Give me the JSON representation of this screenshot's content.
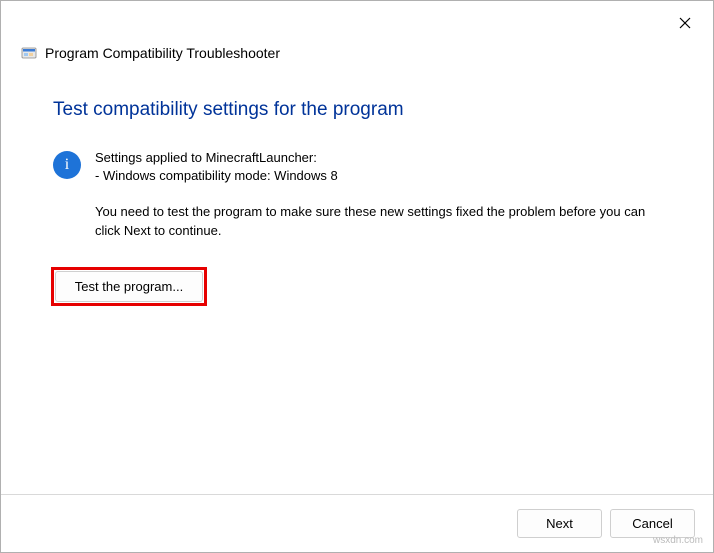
{
  "header": {
    "title": "Program Compatibility Troubleshooter"
  },
  "page": {
    "title": "Test compatibility settings for the program"
  },
  "info": {
    "line1": "Settings applied to MinecraftLauncher:",
    "line2": "- Windows compatibility mode: Windows 8"
  },
  "instruction": {
    "text": "You need to test the program to make sure these new settings fixed the problem before you can click Next to continue."
  },
  "buttons": {
    "test": "Test the program...",
    "next": "Next",
    "cancel": "Cancel"
  },
  "watermark": "wsxdn.com"
}
